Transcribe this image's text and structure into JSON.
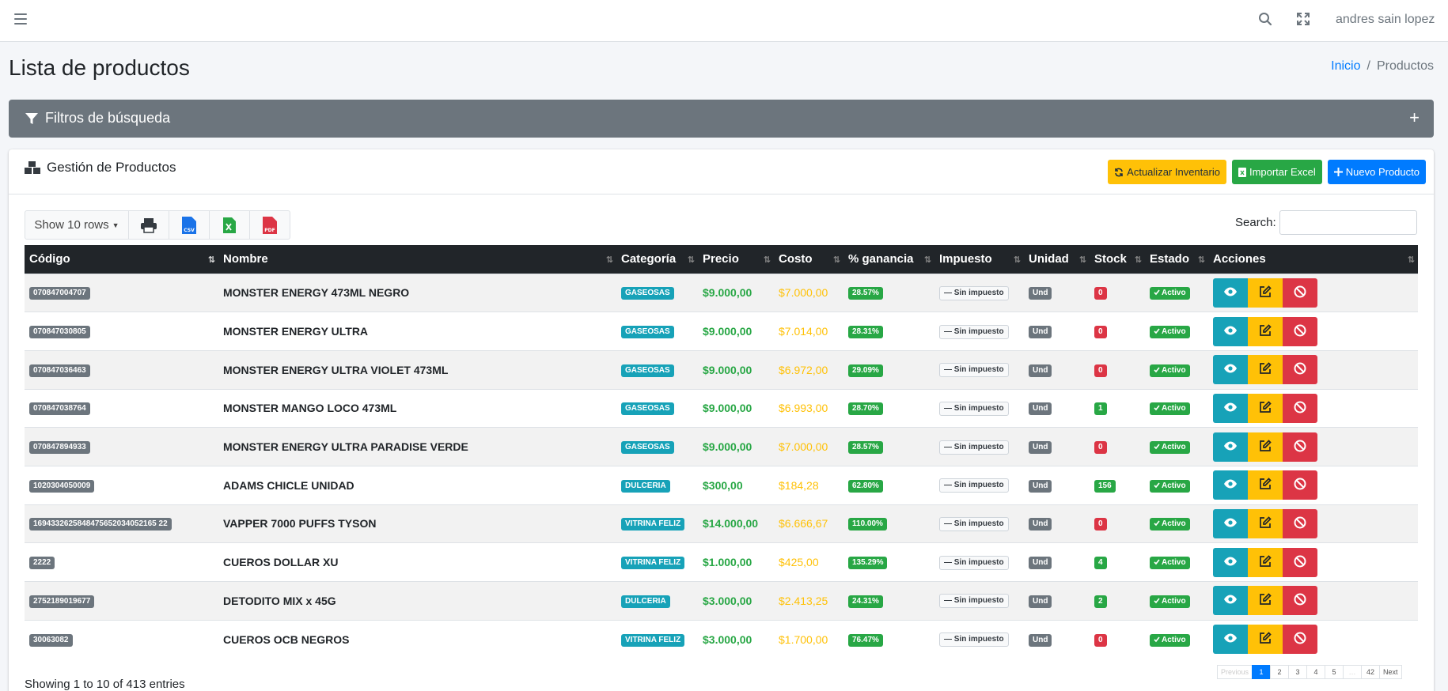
{
  "navbar": {
    "user": "andres sain lopez"
  },
  "page": {
    "title": "Lista de productos"
  },
  "breadcrumb": {
    "home": "Inicio",
    "current": "Productos"
  },
  "filters": {
    "title": "Filtros de búsqueda",
    "toggle": "+"
  },
  "card": {
    "title": "Gestión de Productos",
    "btn_update": "Actualizar Inventario",
    "btn_import": "Importar Excel",
    "btn_new": "Nuevo Producto"
  },
  "toolbar": {
    "rows": "Show 10 rows",
    "search_label": "Search:"
  },
  "table": {
    "headers": [
      "Código",
      "Nombre",
      "Categoría",
      "Precio",
      "Costo",
      "% ganancia",
      "Impuesto",
      "Unidad",
      "Stock",
      "Estado",
      "Acciones"
    ],
    "rows": [
      {
        "code": "070847004707",
        "name": "MONSTER ENERGY 473ML NEGRO",
        "cat": "GASEOSAS",
        "price": "$9.000,00",
        "cost": "$7.000,00",
        "pct": "28.57%",
        "tax": "Sin impuesto",
        "unit": "Und",
        "stock": "0",
        "status": "Activo"
      },
      {
        "code": "070847030805",
        "name": "MONSTER ENERGY ULTRA",
        "cat": "GASEOSAS",
        "price": "$9.000,00",
        "cost": "$7.014,00",
        "pct": "28.31%",
        "tax": "Sin impuesto",
        "unit": "Und",
        "stock": "0",
        "status": "Activo"
      },
      {
        "code": "070847036463",
        "name": "MONSTER ENERGY ULTRA VIOLET 473ML",
        "cat": "GASEOSAS",
        "price": "$9.000,00",
        "cost": "$6.972,00",
        "pct": "29.09%",
        "tax": "Sin impuesto",
        "unit": "Und",
        "stock": "0",
        "status": "Activo"
      },
      {
        "code": "070847038764",
        "name": "MONSTER MANGO LOCO 473ML",
        "cat": "GASEOSAS",
        "price": "$9.000,00",
        "cost": "$6.993,00",
        "pct": "28.70%",
        "tax": "Sin impuesto",
        "unit": "Und",
        "stock": "1",
        "status": "Activo"
      },
      {
        "code": "070847894933",
        "name": "MONSTER ENERGY ULTRA PARADISE VERDE",
        "cat": "GASEOSAS",
        "price": "$9.000,00",
        "cost": "$7.000,00",
        "pct": "28.57%",
        "tax": "Sin impuesto",
        "unit": "Und",
        "stock": "0",
        "status": "Activo"
      },
      {
        "code": "1020304050009",
        "name": "ADAMS CHICLE UNIDAD",
        "cat": "DULCERIA",
        "price": "$300,00",
        "cost": "$184,28",
        "pct": "62.80%",
        "tax": "Sin impuesto",
        "unit": "Und",
        "stock": "156",
        "status": "Activo"
      },
      {
        "code": "1694332625848475652034052165 22",
        "name": "VAPPER 7000 PUFFS TYSON",
        "cat": "VITRINA FELIZ",
        "price": "$14.000,00",
        "cost": "$6.666,67",
        "pct": "110.00%",
        "tax": "Sin impuesto",
        "unit": "Und",
        "stock": "0",
        "status": "Activo"
      },
      {
        "code": "2222",
        "name": "CUEROS DOLLAR XU",
        "cat": "VITRINA FELIZ",
        "price": "$1.000,00",
        "cost": "$425,00",
        "pct": "135.29%",
        "tax": "Sin impuesto",
        "unit": "Und",
        "stock": "4",
        "status": "Activo"
      },
      {
        "code": "2752189019677",
        "name": "DETODITO MIX x 45G",
        "cat": "DULCERIA",
        "price": "$3.000,00",
        "cost": "$2.413,25",
        "pct": "24.31%",
        "tax": "Sin impuesto",
        "unit": "Und",
        "stock": "2",
        "status": "Activo"
      },
      {
        "code": "30063082",
        "name": "CUEROS OCB NEGROS",
        "cat": "VITRINA FELIZ",
        "price": "$3.000,00",
        "cost": "$1.700,00",
        "pct": "76.47%",
        "tax": "Sin impuesto",
        "unit": "Und",
        "stock": "0",
        "status": "Activo"
      }
    ]
  },
  "footer": {
    "info": "Showing 1 to 10 of 413 entries"
  },
  "pagination": {
    "prev": "Previous",
    "pages": [
      "1",
      "2",
      "3",
      "4",
      "5",
      "…",
      "42"
    ],
    "next": "Next"
  }
}
